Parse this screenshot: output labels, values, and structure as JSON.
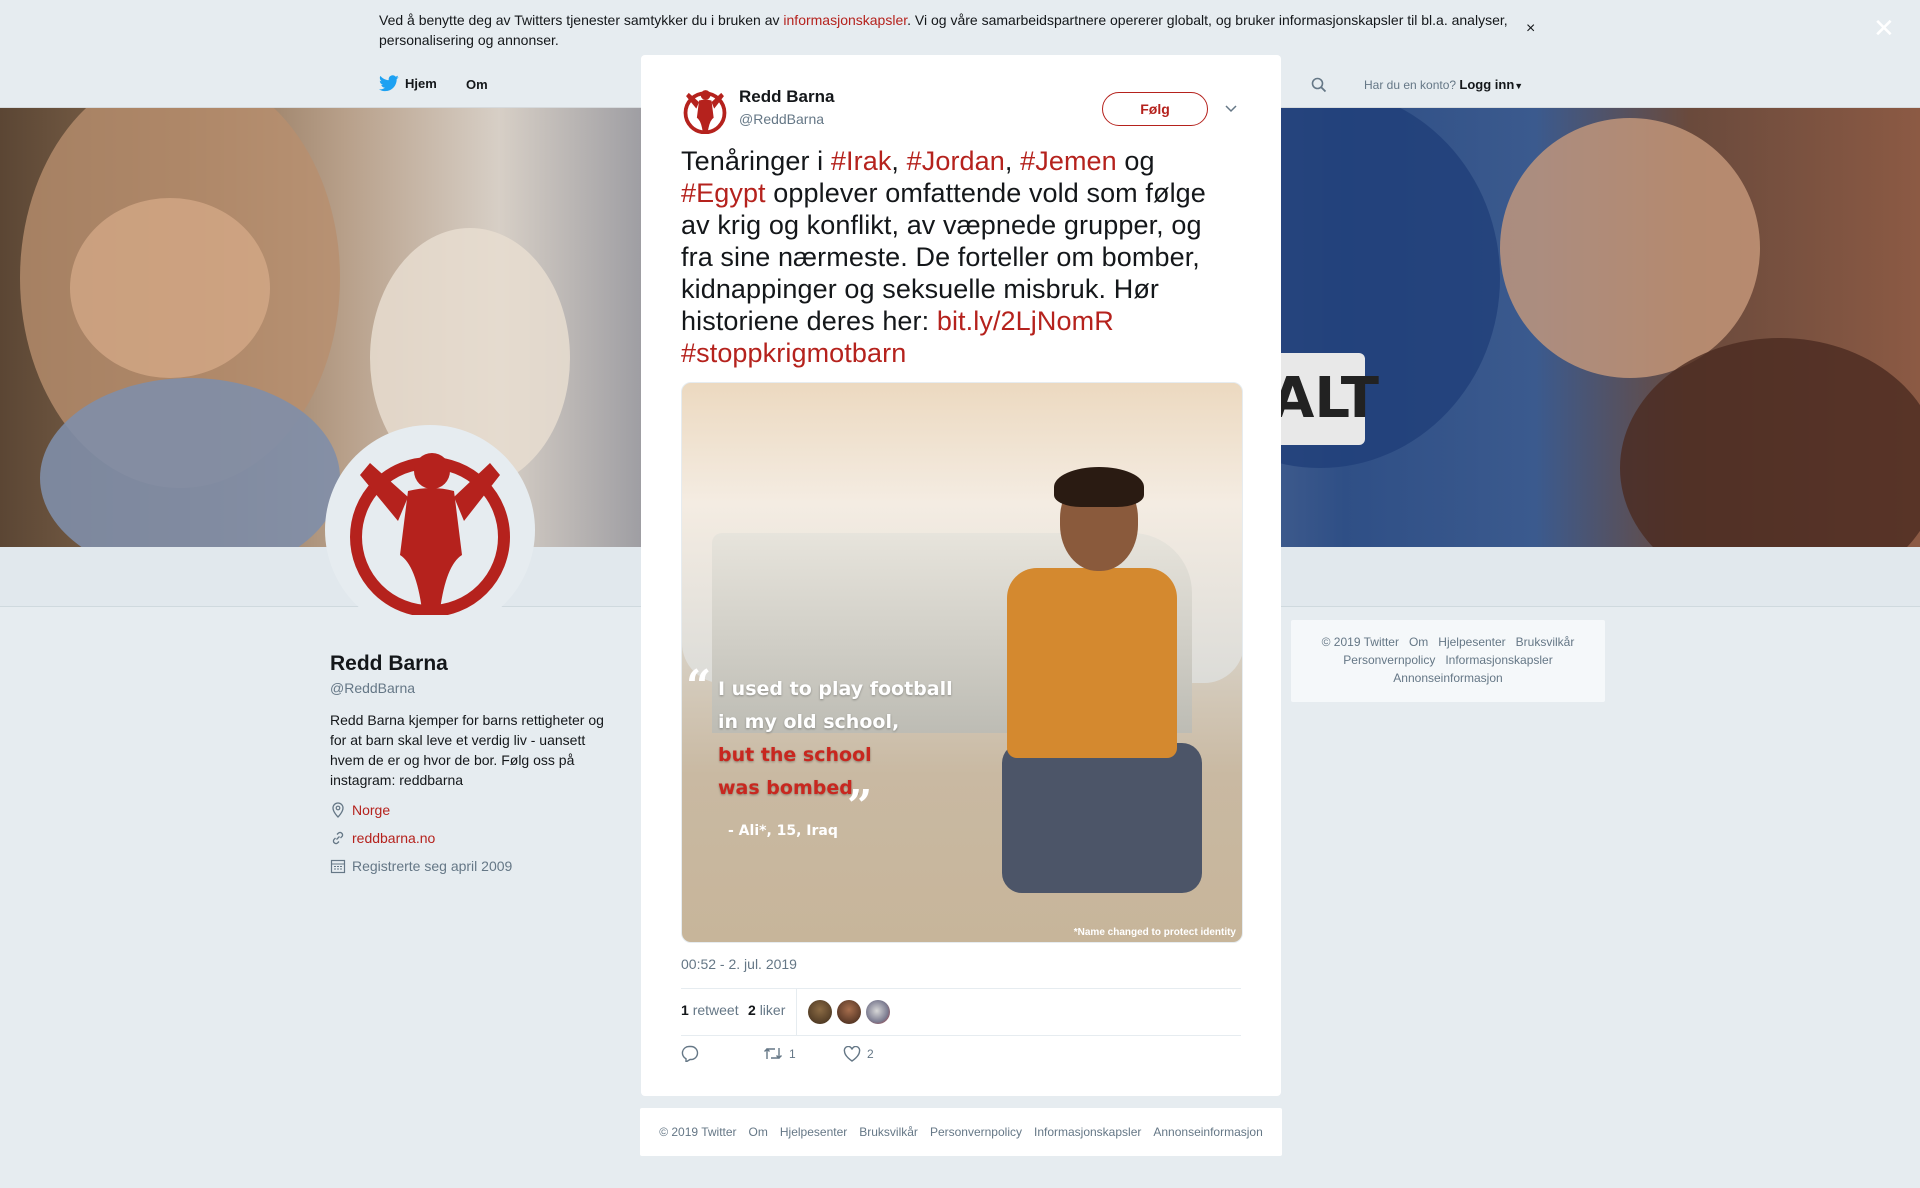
{
  "cookie_banner": {
    "text_before": "Ved å benytte deg av Twitters tjenester samtykker du i bruken av ",
    "link": "informasjonskapsler",
    "text_after": ". Vi og våre samarbeidspartnere opererer globalt, og bruker informasjonskapsler til bl.a. analyser, personalisering og annonser.",
    "close": "×"
  },
  "nav": {
    "home": "Hjem",
    "about": "Om",
    "account_prompt": "Har du en konto?",
    "login": "Logg inn"
  },
  "header": {
    "sign_text": "ALT"
  },
  "profile": {
    "name": "Redd Barna",
    "handle": "@ReddBarna",
    "bio": "Redd Barna kjemper for barns rettigheter og for at barn skal leve et verdig liv - uansett hvem de er og hvor de bor. Følg oss på instagram: reddbarna",
    "location": "Norge",
    "website": "reddbarna.no",
    "joined": "Registrerte seg april 2009"
  },
  "side_footer": {
    "line1": [
      "© 2019 Twitter",
      "Om",
      "Hjelpesenter",
      "Bruksvilkår"
    ],
    "line2": [
      "Personvernpolicy",
      "Informasjonskapsler"
    ],
    "line3": [
      "Annonseinformasjon"
    ]
  },
  "overlay": {
    "close": "✕"
  },
  "tweet": {
    "name": "Redd Barna",
    "handle": "@ReddBarna",
    "follow": "Følg",
    "text_1": "Tenåringer i ",
    "tag_irak": "#Irak",
    "sep_1": ", ",
    "tag_jordan": "#Jordan",
    "sep_2": ", ",
    "tag_jemen": "#Jemen",
    "text_2": " og ",
    "tag_egypt": "#Egypt",
    "text_3": " opplever omfattende vold som følge av krig og konflikt, av væpnede grupper, og fra sine nærmeste. De forteller om bomber, kidnappinger og seksuelle misbruk. Hør historiene deres her: ",
    "link": "bit.ly/2LjNomR",
    "tag_last": "#stoppkrigmotbarn",
    "media": {
      "quote_line1": "I used to play football",
      "quote_line2": "in my old school,",
      "quote_line3": "but the school",
      "quote_line4": "was bombed.",
      "quote_open": "“",
      "quote_close": "”",
      "attribution": "- Ali*, 15, Iraq",
      "watermark": "*Name changed to protect identity"
    },
    "timestamp": "00:52 - 2. jul. 2019",
    "retweets_count": "1",
    "retweets_label": "retweet",
    "likes_count": "2",
    "likes_label": "liker",
    "action_retweet_count": "1",
    "action_like_count": "2"
  },
  "modal_footer": [
    "© 2019 Twitter",
    "Om",
    "Hjelpesenter",
    "Bruksvilkår",
    "Personvernpolicy",
    "Informasjonskapsler",
    "Annonseinformasjon"
  ],
  "colors": {
    "brand": "#b5221d",
    "muted": "#657786",
    "text": "#14171a",
    "bg": "#e6ecf0"
  },
  "icons": [
    "twitter-bird-icon",
    "search-icon",
    "caret-down-icon",
    "location-icon",
    "link-icon",
    "calendar-icon",
    "chevron-down-icon",
    "reply-icon",
    "retweet-icon",
    "heart-icon",
    "close-icon"
  ]
}
